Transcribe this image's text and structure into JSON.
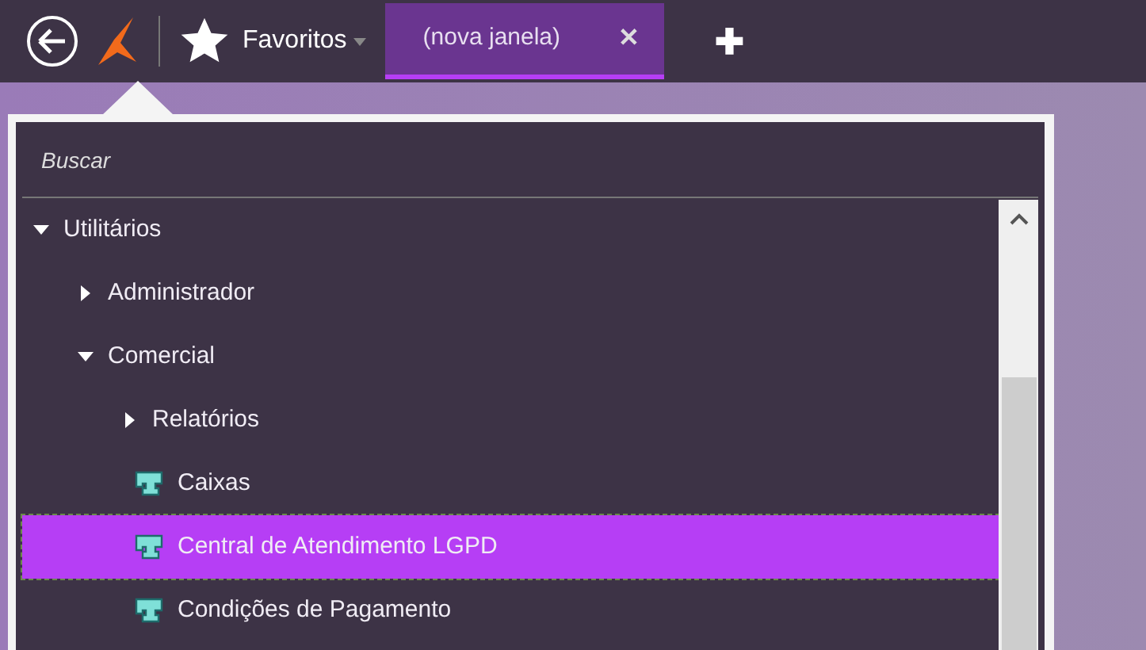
{
  "toolbar": {
    "favorites_label": "Favoritos"
  },
  "tabs": [
    {
      "label": "(nova janela)",
      "selected": true,
      "close": "✕"
    }
  ],
  "new_tab": "✚",
  "menu": {
    "search": {
      "placeholder": "Buscar"
    },
    "tree": [
      {
        "kind": "folder",
        "label": "Utilitários",
        "expanded": true,
        "selected": false,
        "children": [
          {
            "kind": "folder",
            "label": "Administrador",
            "expanded": false,
            "selected": false
          },
          {
            "kind": "folder",
            "label": "Comercial",
            "expanded": true,
            "selected": false,
            "children": [
              {
                "kind": "folder",
                "label": "Relatórios",
                "expanded": false,
                "selected": false
              },
              {
                "kind": "item",
                "label": "Caixas",
                "selected": false
              },
              {
                "kind": "item",
                "label": "Central de Atendimento LGPD",
                "selected": true
              },
              {
                "kind": "item",
                "label": "Condições de Pagamento",
                "selected": false
              }
            ]
          }
        ]
      }
    ]
  }
}
